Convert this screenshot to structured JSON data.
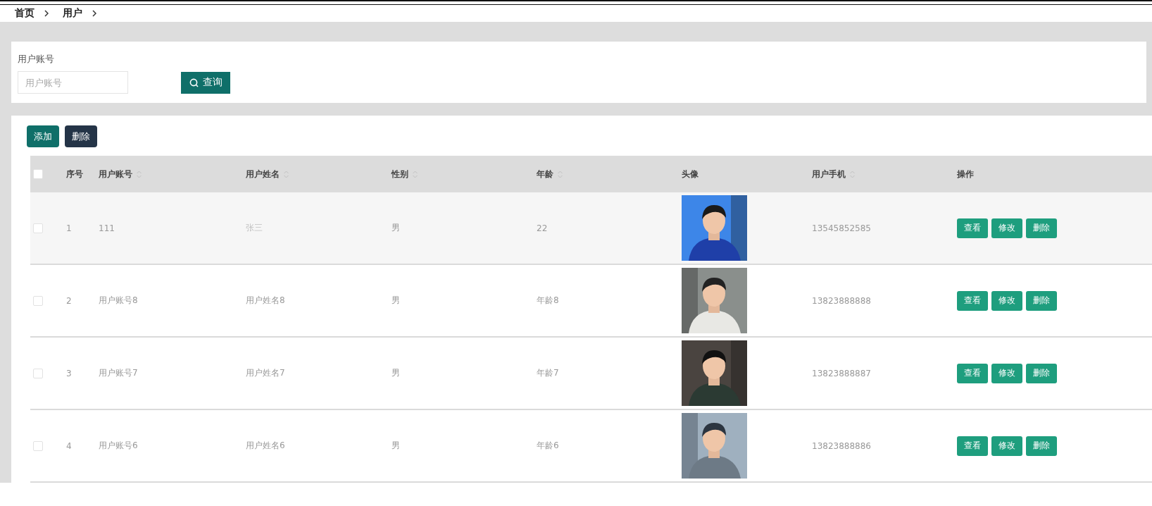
{
  "breadcrumb": [
    {
      "label": "首页"
    },
    {
      "label": "用户"
    }
  ],
  "search": {
    "label": "用户账号",
    "placeholder": "用户账号",
    "button": "查询"
  },
  "toolbar": [
    {
      "label": "添加",
      "kind": "primary"
    },
    {
      "label": "删除",
      "kind": "danger"
    }
  ],
  "table": {
    "select_all": {
      "checked": false
    },
    "columns": [
      {
        "label": "序号",
        "sortable": false
      },
      {
        "label": "用户账号",
        "sortable": true
      },
      {
        "label": "用户姓名",
        "sortable": true
      },
      {
        "label": "性别",
        "sortable": true
      },
      {
        "label": "年龄",
        "sortable": true
      },
      {
        "label": "头像",
        "sortable": false
      },
      {
        "label": "用户手机",
        "sortable": true
      },
      {
        "label": "操作",
        "sortable": false
      }
    ],
    "rows": [
      {
        "selected": false,
        "highlighted": true,
        "index": "1",
        "account": "111",
        "name": "张三",
        "gender": "男",
        "age": "22",
        "avatar": {
          "kind": "picture"
        },
        "phone": "13545852585",
        "actions": [
          "查看",
          "修改",
          "删除"
        ]
      },
      {
        "selected": false,
        "highlighted": false,
        "index": "2",
        "account": "用户账号8",
        "name": "用户姓名8",
        "gender": "男",
        "age": "年龄8",
        "avatar": {
          "kind": "picture"
        },
        "phone": "13823888888",
        "actions": [
          "查看",
          "修改",
          "删除"
        ]
      },
      {
        "selected": false,
        "highlighted": false,
        "index": "3",
        "account": "用户账号7",
        "name": "用户姓名7",
        "gender": "男",
        "age": "年龄7",
        "avatar": {
          "kind": "picture"
        },
        "phone": "13823888887",
        "actions": [
          "查看",
          "修改",
          "删除"
        ]
      },
      {
        "selected": false,
        "highlighted": false,
        "index": "4",
        "account": "用户账号6",
        "name": "用户姓名6",
        "gender": "男",
        "age": "年龄6",
        "avatar": {
          "kind": "picture"
        },
        "phone": "13823888886",
        "actions": [
          "查看",
          "修改",
          "删除"
        ]
      }
    ]
  }
}
